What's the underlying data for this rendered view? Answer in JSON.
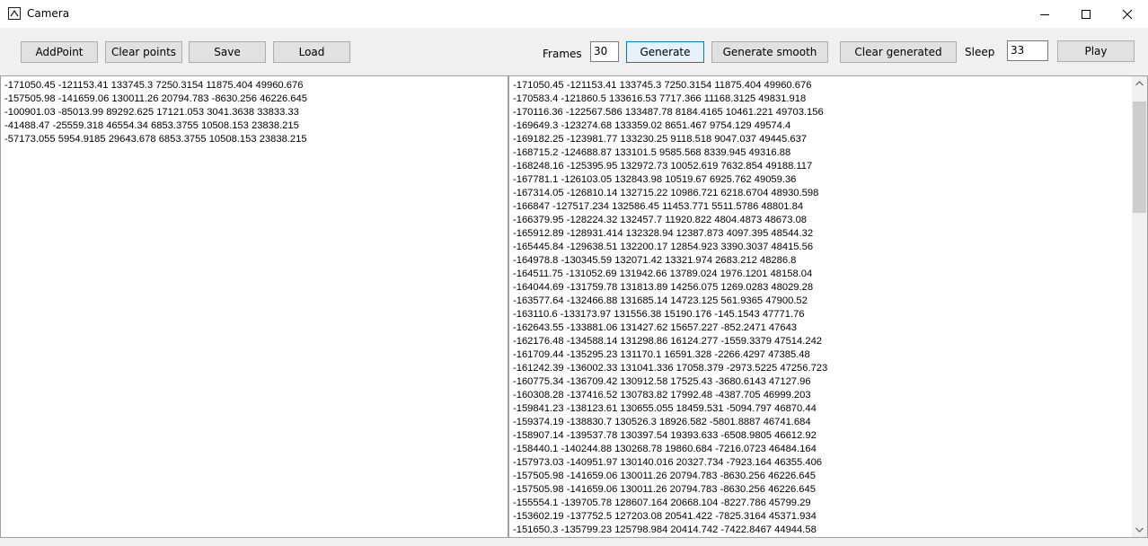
{
  "window": {
    "title": "Camera",
    "minimize_glyph": "minimize-icon",
    "maximize_glyph": "maximize-icon",
    "close_glyph": "close-icon"
  },
  "toolbar": {
    "add_point": "AddPoint",
    "clear_points": "Clear points",
    "save": "Save",
    "load": "Load",
    "frames_label": "Frames",
    "frames_value": "30",
    "generate": "Generate",
    "generate_smooth": "Generate smooth",
    "clear_generated": "Clear generated",
    "sleep_label": "Sleep",
    "sleep_value": "33",
    "play": "Play"
  },
  "points": [
    "-171050.45 -121153.41 133745.3 7250.3154 11875.404 49960.676",
    "-157505.98 -141659.06 130011.26 20794.783 -8630.256 46226.645",
    "-100901.03 -85013.99 89292.625 17121.053 3041.3638 33833.33",
    "-41488.47 -25559.318 46554.34 6853.3755 10508.153 23838.215",
    "-57173.055 5954.9185 29643.678 6853.3755 10508.153 23838.215"
  ],
  "generated": [
    "-171050.45 -121153.41 133745.3 7250.3154 11875.404 49960.676",
    "-170583.4 -121860.5 133616.53 7717.366 11168.3125 49831.918",
    "-170116.36 -122567.586 133487.78 8184.4165 10461.221 49703.156",
    "-169649.3 -123274.68 133359.02 8651.467 9754.129 49574.4",
    "-169182.25 -123981.77 133230.25 9118.518 9047.037 49445.637",
    "-168715.2 -124688.87 133101.5 9585.568 8339.945 49316.88",
    "-168248.16 -125395.95 132972.73 10052.619 7632.854 49188.117",
    "-167781.1 -126103.05 132843.98 10519.67 6925.762 49059.36",
    "-167314.05 -126810.14 132715.22 10986.721 6218.6704 48930.598",
    "-166847 -127517.234 132586.45 11453.771 5511.5786 48801.84",
    "-166379.95 -128224.32 132457.7 11920.822 4804.4873 48673.08",
    "-165912.89 -128931.414 132328.94 12387.873 4097.395 48544.32",
    "-165445.84 -129638.51 132200.17 12854.923 3390.3037 48415.56",
    "-164978.8 -130345.59 132071.42 13321.974 2683.212 48286.8",
    "-164511.75 -131052.69 131942.66 13789.024 1976.1201 48158.04",
    "-164044.69 -131759.78 131813.89 14256.075 1269.0283 48029.28",
    "-163577.64 -132466.88 131685.14 14723.125 561.9365 47900.52",
    "-163110.6 -133173.97 131556.38 15190.176 -145.1543 47771.76",
    "-162643.55 -133881.06 131427.62 15657.227 -852.2471 47643",
    "-162176.48 -134588.14 131298.86 16124.277 -1559.3379 47514.242",
    "-161709.44 -135295.23 131170.1 16591.328 -2266.4297 47385.48",
    "-161242.39 -136002.33 131041.336 17058.379 -2973.5225 47256.723",
    "-160775.34 -136709.42 130912.58 17525.43 -3680.6143 47127.96",
    "-160308.28 -137416.52 130783.82 17992.48 -4387.705 46999.203",
    "-159841.23 -138123.61 130655.055 18459.531 -5094.797 46870.44",
    "-159374.19 -138830.7 130526.3 18926.582 -5801.8887 46741.684",
    "-158907.14 -139537.78 130397.54 19393.633 -6508.9805 46612.92",
    "-158440.1 -140244.88 130268.78 19860.684 -7216.0723 46484.164",
    "-157973.03 -140951.97 130140.016 20327.734 -7923.164 46355.406",
    "-157505.98 -141659.06 130011.26 20794.783 -8630.256 46226.645",
    "-157505.98 -141659.06 130011.26 20794.783 -8630.256 46226.645",
    "-155554.1 -139705.78 128607.164 20668.104 -8227.786 45799.29",
    "-153602.19 -137752.5 127203.08 20541.422 -7825.3164 45371.934",
    "-151650.3 -135799.23 125798.984 20414.742 -7422.8467 44944.58"
  ]
}
